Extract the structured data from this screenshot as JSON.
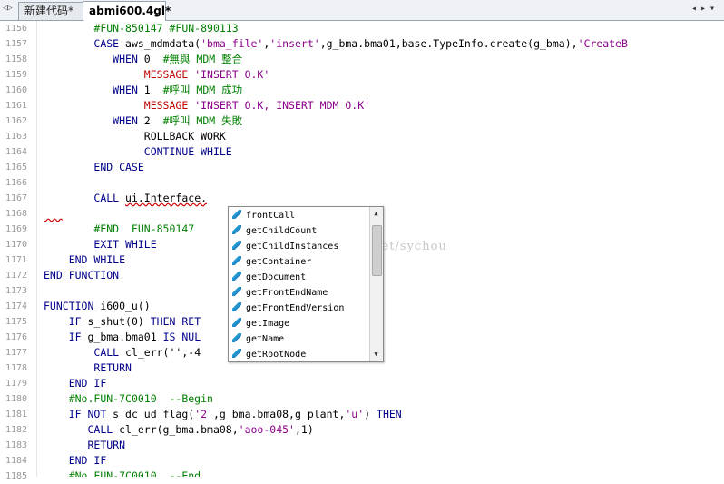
{
  "tabs": [
    {
      "label": "新建代码*"
    },
    {
      "label": "abmi600.4gl*"
    }
  ],
  "window_controls": {
    "left": "◁▷",
    "right": "◂▸▾"
  },
  "watermark": "g.csdn.net/sychou",
  "lines": [
    {
      "n": "1156",
      "segs": [
        {
          "t": "        "
        },
        {
          "t": "#FUN-850147 #FUN-890113",
          "c": "cm"
        }
      ]
    },
    {
      "n": "1157",
      "segs": [
        {
          "t": "        "
        },
        {
          "t": "CASE",
          "c": "kw"
        },
        {
          "t": " aws_mdmdata("
        },
        {
          "t": "'bma_file'",
          "c": "str"
        },
        {
          "t": ","
        },
        {
          "t": "'insert'",
          "c": "str"
        },
        {
          "t": ",g_bma.bma01,base.TypeInfo.create(g_bma),"
        },
        {
          "t": "'CreateB",
          "c": "str"
        }
      ]
    },
    {
      "n": "1158",
      "segs": [
        {
          "t": "           "
        },
        {
          "t": "WHEN",
          "c": "kw"
        },
        {
          "t": " 0  "
        },
        {
          "t": "#無與 MDM 整合",
          "c": "cm"
        }
      ]
    },
    {
      "n": "1159",
      "segs": [
        {
          "t": "                "
        },
        {
          "t": "MESSAGE",
          "c": "red"
        },
        {
          "t": " "
        },
        {
          "t": "'INSERT O.K'",
          "c": "str"
        }
      ]
    },
    {
      "n": "1160",
      "segs": [
        {
          "t": "           "
        },
        {
          "t": "WHEN",
          "c": "kw"
        },
        {
          "t": " 1  "
        },
        {
          "t": "#呼叫 MDM 成功",
          "c": "cm"
        }
      ]
    },
    {
      "n": "1161",
      "segs": [
        {
          "t": "                "
        },
        {
          "t": "MESSAGE",
          "c": "red"
        },
        {
          "t": " "
        },
        {
          "t": "'INSERT O.K, INSERT MDM O.K'",
          "c": "str"
        }
      ]
    },
    {
      "n": "1162",
      "segs": [
        {
          "t": "           "
        },
        {
          "t": "WHEN",
          "c": "kw"
        },
        {
          "t": " 2  "
        },
        {
          "t": "#呼叫 MDM 失敗",
          "c": "cm"
        }
      ]
    },
    {
      "n": "1163",
      "segs": [
        {
          "t": "                ROLLBACK WORK"
        }
      ]
    },
    {
      "n": "1164",
      "segs": [
        {
          "t": "                "
        },
        {
          "t": "CONTINUE WHILE",
          "c": "kw"
        }
      ]
    },
    {
      "n": "1165",
      "segs": [
        {
          "t": "        "
        },
        {
          "t": "END CASE",
          "c": "kw"
        }
      ]
    },
    {
      "n": "1166",
      "segs": []
    },
    {
      "n": "1167",
      "segs": [
        {
          "t": "        "
        },
        {
          "t": "CALL",
          "c": "kw"
        },
        {
          "t": " "
        },
        {
          "t": "ui.Interface.",
          "c": "sq"
        }
      ]
    },
    {
      "n": "1168",
      "segs": [
        {
          "t": "   ",
          "c": "sq"
        }
      ]
    },
    {
      "n": "1169",
      "segs": [
        {
          "t": "        "
        },
        {
          "t": "#END  FUN-850147",
          "c": "cm"
        }
      ]
    },
    {
      "n": "1170",
      "segs": [
        {
          "t": "        "
        },
        {
          "t": "EXIT WHILE",
          "c": "kw"
        }
      ]
    },
    {
      "n": "1171",
      "segs": [
        {
          "t": "    "
        },
        {
          "t": "END WHILE",
          "c": "kw"
        }
      ]
    },
    {
      "n": "1172",
      "segs": [
        {
          "t": "END FUNCTION",
          "c": "kw"
        }
      ]
    },
    {
      "n": "1173",
      "segs": []
    },
    {
      "n": "1174",
      "segs": [
        {
          "t": "FUNCTION",
          "c": "kw"
        },
        {
          "t": " i600_u()"
        }
      ]
    },
    {
      "n": "1175",
      "segs": [
        {
          "t": "    "
        },
        {
          "t": "IF",
          "c": "kw"
        },
        {
          "t": " s_shut(0) "
        },
        {
          "t": "THEN RET",
          "c": "kw"
        }
      ]
    },
    {
      "n": "1176",
      "segs": [
        {
          "t": "    "
        },
        {
          "t": "IF",
          "c": "kw"
        },
        {
          "t": " g_bma.bma01 "
        },
        {
          "t": "IS NUL",
          "c": "kw"
        }
      ]
    },
    {
      "n": "1177",
      "segs": [
        {
          "t": "        "
        },
        {
          "t": "CALL",
          "c": "kw"
        },
        {
          "t": " cl_err(''"
        },
        {
          "t": ",-4"
        }
      ]
    },
    {
      "n": "1178",
      "segs": [
        {
          "t": "        "
        },
        {
          "t": "RETURN",
          "c": "kw"
        }
      ]
    },
    {
      "n": "1179",
      "segs": [
        {
          "t": "    "
        },
        {
          "t": "END IF",
          "c": "kw"
        }
      ]
    },
    {
      "n": "1180",
      "segs": [
        {
          "t": "    "
        },
        {
          "t": "#No.FUN-7C0010  --Begin",
          "c": "cm"
        }
      ]
    },
    {
      "n": "1181",
      "segs": [
        {
          "t": "    "
        },
        {
          "t": "IF NOT",
          "c": "kw"
        },
        {
          "t": " s_dc_ud_flag("
        },
        {
          "t": "'2'",
          "c": "str"
        },
        {
          "t": ",g_bma.bma08,g_plant,"
        },
        {
          "t": "'u'",
          "c": "str"
        },
        {
          "t": ") "
        },
        {
          "t": "THEN",
          "c": "kw"
        }
      ]
    },
    {
      "n": "1182",
      "segs": [
        {
          "t": "       "
        },
        {
          "t": "CALL",
          "c": "kw"
        },
        {
          "t": " cl_err(g_bma.bma08,"
        },
        {
          "t": "'aoo-045'",
          "c": "str"
        },
        {
          "t": ",1)"
        }
      ]
    },
    {
      "n": "1183",
      "segs": [
        {
          "t": "       "
        },
        {
          "t": "RETURN",
          "c": "kw"
        }
      ]
    },
    {
      "n": "1184",
      "segs": [
        {
          "t": "    "
        },
        {
          "t": "END IF",
          "c": "kw"
        }
      ]
    },
    {
      "n": "1185",
      "segs": [
        {
          "t": "    "
        },
        {
          "t": "#No.FUN-7C0010  --End",
          "c": "cm"
        }
      ]
    }
  ],
  "popup_items": [
    "frontCall",
    "getChildCount",
    "getChildInstances",
    "getContainer",
    "getDocument",
    "getFrontEndName",
    "getFrontEndVersion",
    "getImage",
    "getName",
    "getRootNode"
  ],
  "colors": {
    "keyword": "#00008b",
    "string": "#8b008b",
    "comment": "#008000",
    "message": "#c00000"
  }
}
